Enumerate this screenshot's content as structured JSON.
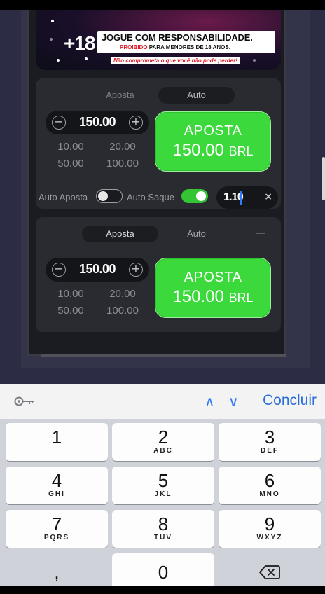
{
  "banner": {
    "age": "+18",
    "title": "JOGUE COM RESPONSABILIDADE.",
    "subtitle_red": "PROIBIDO",
    "subtitle_rest": " PARA MENORES DE 18 ANOS.",
    "warning": "Não comprometa o que você não pode perder!"
  },
  "panel1": {
    "tabs": [
      "Aposta",
      "Auto"
    ],
    "amount": "150.00",
    "minus_symbol": "−",
    "plus_symbol": "+",
    "quick_amounts": [
      "10.00",
      "20.00",
      "50.00",
      "100.00"
    ],
    "bet_button": {
      "line1": "APOSTA",
      "amount": "150.00",
      "currency": "BRL"
    }
  },
  "auto_row": {
    "auto_bet_label": "Auto Aposta",
    "auto_bet_enabled": false,
    "auto_cashout_label": "Auto Saque",
    "auto_cashout_enabled": true,
    "multiplier_value": "1.10",
    "clear_symbol": "×"
  },
  "panel2": {
    "tabs": [
      "Aposta",
      "Auto"
    ],
    "amount": "150.00",
    "minus_symbol": "−",
    "plus_symbol": "+",
    "quick_amounts": [
      "10.00",
      "20.00",
      "50.00",
      "100.00"
    ],
    "bet_button": {
      "line1": "APOSTA",
      "amount": "150.00",
      "currency": "BRL"
    }
  },
  "keyboard": {
    "prev_arrow": "∧",
    "next_arrow": "∨",
    "done_label": "Concluir",
    "keys": [
      {
        "num": "1",
        "letters": ""
      },
      {
        "num": "2",
        "letters": "ABC"
      },
      {
        "num": "3",
        "letters": "DEF"
      },
      {
        "num": "4",
        "letters": "GHI"
      },
      {
        "num": "5",
        "letters": "JKL"
      },
      {
        "num": "6",
        "letters": "MNO"
      },
      {
        "num": "7",
        "letters": "PQRS"
      },
      {
        "num": "8",
        "letters": "TUV"
      },
      {
        "num": "9",
        "letters": "WXYZ"
      }
    ],
    "comma": ",",
    "zero": "0",
    "backspace_icon": "backspace-icon"
  },
  "colors": {
    "bet_green": "#3bd93b",
    "toggle_on": "#34c434",
    "accent_blue": "#2a6fd8",
    "warning_red": "#e21b2a"
  }
}
